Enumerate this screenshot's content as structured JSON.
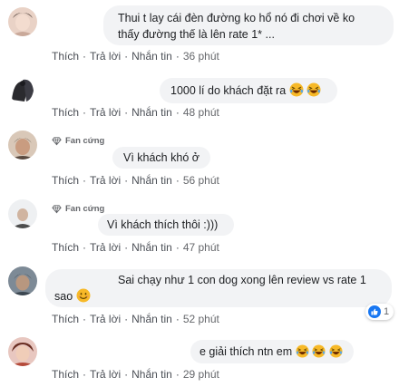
{
  "actions": {
    "like": "Thích",
    "reply": "Trả lời",
    "message": "Nhắn tin",
    "sep": "·"
  },
  "comments": [
    {
      "text_line1": "Thui t lay cái đèn đường ko hổ nó đi chơi về ko",
      "text_line2": "thấy đường thế là lên rate 1* ...",
      "time": "36 phút"
    },
    {
      "text": "1000 lí do khách đặt ra",
      "time": "48 phút"
    },
    {
      "badge": "Fan cứng",
      "text": "Vì khách khó ở",
      "time": "56 phút"
    },
    {
      "badge": "Fan cứng",
      "text": "Vì khách thích thôi :)))",
      "time": "47 phút"
    },
    {
      "text_line1": "Sai chạy như 1 con dog xong lên review vs rate 1",
      "text_line2": "sao",
      "time": "52 phút",
      "reaction_count": "1"
    },
    {
      "text": "e giải thích ntn em",
      "time": "29 phút"
    }
  ],
  "icons": {
    "diamond": "diamond-icon",
    "laugh": "laughing-emoji-icon",
    "smile": "smile-emoji-icon",
    "like": "like-reaction-icon"
  },
  "colors": {
    "bubble": "#f2f3f5",
    "action_text": "#4b4f56",
    "like_blue": "#1877f2",
    "emoji_yellow": "#f7b928"
  }
}
